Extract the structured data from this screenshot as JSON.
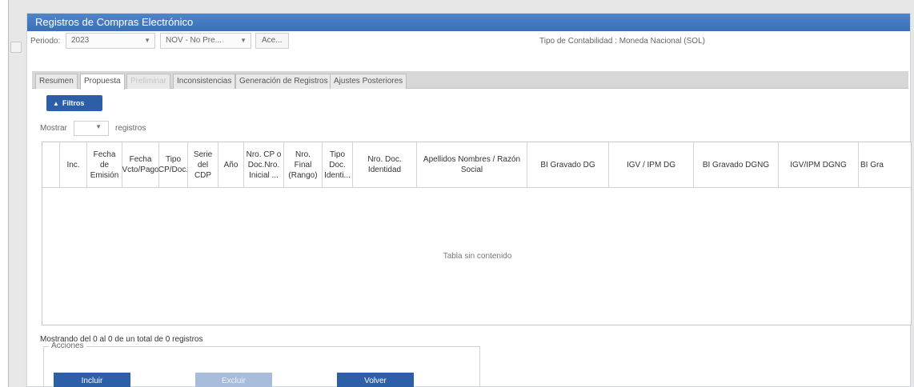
{
  "window": {
    "title": "Registros de Compras Electrónico"
  },
  "toolbar": {
    "periodo_label": "Periodo:",
    "year_value": "2023",
    "month_value": "NOV - No Pre...",
    "ace_button": "Ace...",
    "tipo_contabilidad": "Tipo de Contabilidad : Moneda Nacional (SOL)"
  },
  "tabs": [
    {
      "label": "Resumen",
      "state": "normal"
    },
    {
      "label": "Propuesta",
      "state": "active"
    },
    {
      "label": "Preliminar",
      "state": "disabled"
    },
    {
      "label": "Inconsistencias",
      "state": "normal"
    },
    {
      "label": "Generación de Registros",
      "state": "normal"
    },
    {
      "label": "Ajustes Posteriores",
      "state": "normal"
    }
  ],
  "filtros_button": "Filtros",
  "show_entries": {
    "before": "Mostrar",
    "after": "registros",
    "value": ""
  },
  "table": {
    "columns": [
      "",
      "Inc.",
      "Fecha de Emisión",
      "Fecha Vcto/Pago",
      "Tipo CP/Doc.",
      "Serie del CDP",
      "Año",
      "Nro. CP o Doc.Nro. Inicial ...",
      "Nro. Final (Rango)",
      "Tipo Doc. Identi...",
      "Nro. Doc. Identidad",
      "Apellidos Nombres / Razón Social",
      "BI Gravado DG",
      "IGV / IPM DG",
      "BI Gravado DGNG",
      "IGV/IPM DGNG",
      "BI Gra"
    ],
    "empty_message": "Tabla sin contenido"
  },
  "summary": "Mostrando del 0 al 0 de un total de 0 registros",
  "acciones": {
    "legend": "Acciones",
    "incluir": "Incluir",
    "disabled_button": "Excluir",
    "volver": "Volver"
  },
  "colors": {
    "header_blue": "#3d70b6",
    "button_blue": "#2d5ea8"
  }
}
